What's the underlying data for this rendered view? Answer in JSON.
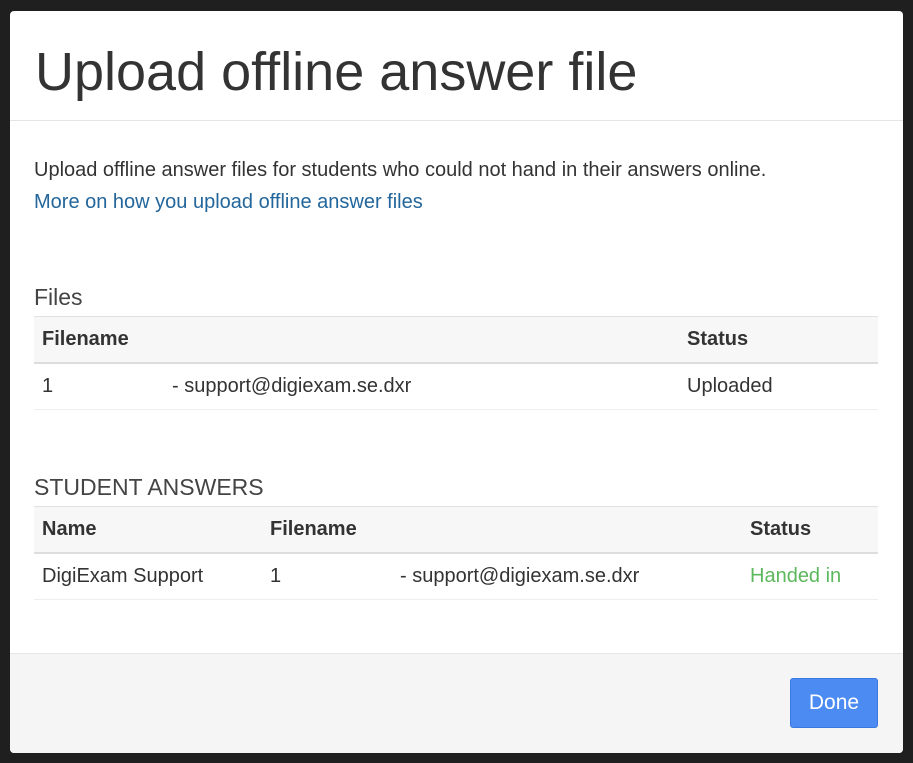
{
  "modal": {
    "title": "Upload offline answer file",
    "intro": "Upload offline answer files for students who could not hand in their answers online.",
    "help_link": "More on how you upload offline answer files"
  },
  "files": {
    "title": "Files",
    "columns": [
      "Filename",
      "Status"
    ],
    "rows": [
      {
        "filename_num": "1",
        "filename_rest": "- support@digiexam.se.dxr",
        "status": "Uploaded"
      }
    ]
  },
  "answers": {
    "title": "STUDENT ANSWERS",
    "columns": [
      "Name",
      "Filename",
      "Status"
    ],
    "rows": [
      {
        "name": "DigiExam Support",
        "filename_num": "1",
        "filename_rest": "- support@digiexam.se.dxr",
        "status": "Handed in"
      }
    ]
  },
  "footer": {
    "done_label": "Done"
  },
  "colors": {
    "accent": "#4c8cf2",
    "link": "#23669b",
    "success": "#5cb85c"
  }
}
